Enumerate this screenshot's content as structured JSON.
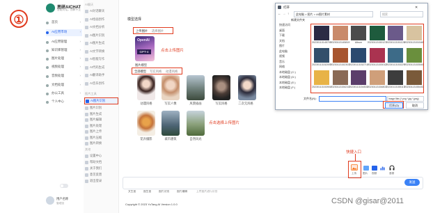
{
  "step_marker": "①",
  "sidebar": {
    "brand_title": "思研AICHAT",
    "brand_subtitle": "智能对话，创新不止",
    "items": [
      {
        "label": "首页"
      },
      {
        "label": "AI应用市场"
      },
      {
        "label": "AI应用管理"
      },
      {
        "label": "知识库管理"
      },
      {
        "label": "图片处理"
      },
      {
        "label": "视频处理"
      },
      {
        "label": "音频处理"
      },
      {
        "label": "文档处理"
      },
      {
        "label": "办公工具"
      },
      {
        "label": "个人中心"
      }
    ],
    "user_name": "用户名称",
    "user_role": "管理员"
  },
  "subnav": {
    "header1": "AI聊天",
    "items1": [
      {
        "label": "AI对话聊天"
      },
      {
        "label": "AI绘画创作"
      },
      {
        "label": "AI文档分析"
      },
      {
        "label": "AI图片识别"
      },
      {
        "label": "AI图片生成"
      },
      {
        "label": "AI文字转换"
      },
      {
        "label": "AI智能写作"
      },
      {
        "label": "AI代码生成"
      },
      {
        "label": "AI翻译助手"
      },
      {
        "label": "AI音乐创作"
      }
    ],
    "header2": "图片工具",
    "items2": [
      {
        "label": "图片识别"
      },
      {
        "label": "图片生成"
      },
      {
        "label": "图片编辑"
      },
      {
        "label": "图片处理"
      },
      {
        "label": "图片上传"
      },
      {
        "label": "图片压缩"
      },
      {
        "label": "图片转换"
      }
    ],
    "active_item": "AI图片识别",
    "header3": "其他",
    "items3": [
      {
        "label": "设置中心"
      },
      {
        "label": "帮助文档"
      },
      {
        "label": "关于我们"
      },
      {
        "label": "意见反馈"
      },
      {
        "label": "退出登录"
      }
    ]
  },
  "main": {
    "title": "模型选择",
    "upload_tabs": [
      "上传图片",
      "选择图片"
    ],
    "gpt_badge": "OpenAI",
    "gpt_label": "GPT-4",
    "upload_hint": "点击上传图片",
    "model_name": "图片模型",
    "filter_tabs": [
      "全部模型",
      "写实风格",
      "动漫风格"
    ],
    "cards": [
      {
        "label": "动漫风格"
      },
      {
        "label": "写实人像"
      },
      {
        "label": "风景插画"
      },
      {
        "label": "写实风格"
      },
      {
        "label": "二次元风格"
      },
      {
        "label": "花卉摄影"
      },
      {
        "label": "城市建筑"
      },
      {
        "label": "自然风光"
      }
    ],
    "card_hint": "点击选择上传图片",
    "quick_entry_hint": "快捷入口",
    "chat_buttons": [
      "上传",
      "图片",
      "视频",
      "音频"
    ],
    "send_label": "发送",
    "footer_links": [
      "文生图",
      "图生图",
      "图片识别",
      "图片编辑"
    ],
    "footer_hint": "上传图片进行识别",
    "copyright": "Copyright © 2023 YuTang AI Version 1.0.0",
    "watermark": "CSDN @gisar@2011"
  },
  "dialog": {
    "title": "打开",
    "path": "此电脑 > 图片 > AI图片素材",
    "search_placeholder": "搜索",
    "toolbar_new_folder": "新建文件夹",
    "tree": [
      "快速访问",
      "桌面",
      "下载",
      "文档",
      "图片",
      "此电脑",
      "视频",
      "音乐",
      "网络",
      "本地磁盘 (C:)",
      "本地磁盘 (D:)",
      "本地磁盘 (E:)",
      "本地磁盘 (F:)"
    ],
    "thumbs": [
      {
        "label": "20230113145705"
      },
      {
        "label": "20230113145819"
      },
      {
        "label": "Album"
      },
      {
        "label": "20230113150127"
      },
      {
        "label": "20230113151128"
      },
      {
        "label": "20230113151548"
      },
      {
        "label": "20230113152005"
      },
      {
        "label": "20230113152301"
      },
      {
        "label": "20230113152714"
      },
      {
        "label": "20230113153012"
      },
      {
        "label": "20230113153229"
      },
      {
        "label": "20230113153544"
      },
      {
        "label": "20230113153904"
      },
      {
        "label": "20230113154210"
      },
      {
        "label": "20230113154530"
      },
      {
        "label": "20230113154801"
      },
      {
        "label": "20230113155115"
      },
      {
        "label": "20230113155430"
      }
    ],
    "filename_label": "文件名(N):",
    "filetype_value": "Image files (*.png *.jpg *.jpeg)",
    "open_button": "打开(O)",
    "cancel_button": "取消"
  },
  "colors": {
    "accent": "#2563eb",
    "annotation": "#e03a1e",
    "brand": "#1f8a70"
  }
}
